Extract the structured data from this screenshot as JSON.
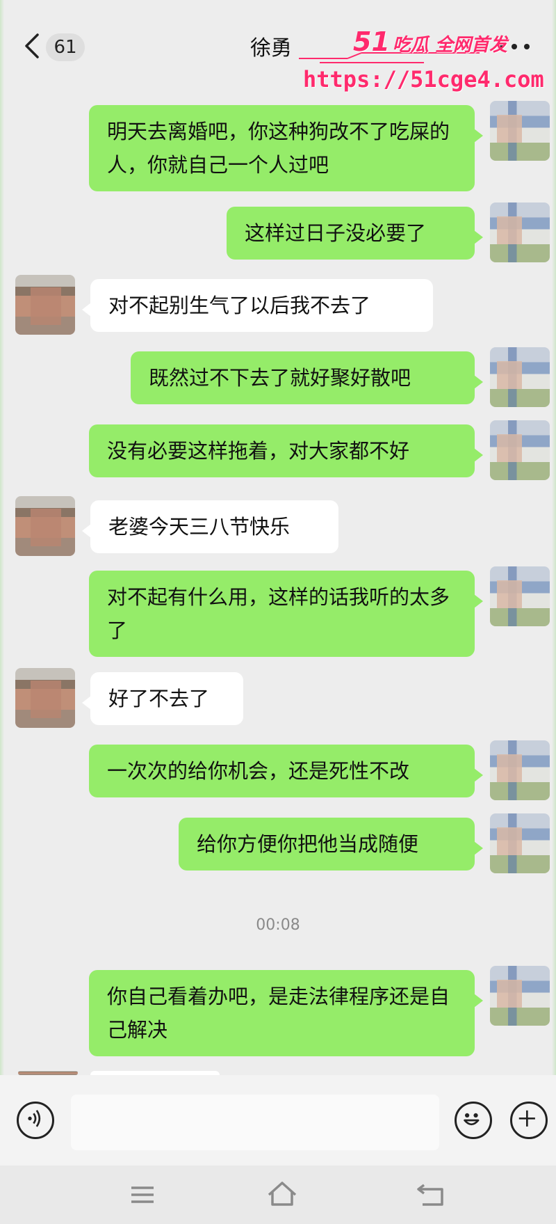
{
  "header": {
    "unread_count": "61",
    "contact_name": "徐勇",
    "watermark_logo": "51",
    "watermark_tag": "吃瓜 全网首发",
    "watermark_url": "https://51cge4.com"
  },
  "messages": [
    {
      "from": "me",
      "text": "明天去离婚吧，你这种狗改不了吃屎的人，你就自己一个人过吧"
    },
    {
      "from": "me",
      "text": "这样过日子没必要了"
    },
    {
      "from": "other",
      "text": "对不起别生气了以后我不去了"
    },
    {
      "from": "me",
      "text": "既然过不下去了就好聚好散吧"
    },
    {
      "from": "me",
      "text": "没有必要这样拖着，对大家都不好"
    },
    {
      "from": "other",
      "text": "老婆今天三八节快乐"
    },
    {
      "from": "me",
      "text": "对不起有什么用，这样的话我听的太多了"
    },
    {
      "from": "other",
      "text": "好了不去了"
    },
    {
      "from": "me",
      "text": "一次次的给你机会，还是死性不改"
    },
    {
      "from": "me",
      "text": "给你方便你把他当成随便"
    },
    {
      "from": "me",
      "text": "你自己看着办吧，是走法律程序还是自己解决"
    }
  ],
  "timestamp": "00:08",
  "icons": {
    "back": "chevron-left-icon",
    "more": "more-dots-icon",
    "voice": "voice-icon",
    "emoji": "emoji-icon",
    "plus": "plus-icon",
    "menu": "menu-icon",
    "home": "home-icon",
    "return": "back-nav-icon"
  },
  "colors": {
    "my_bubble": "#95ec69",
    "their_bubble": "#ffffff",
    "background": "#ededed",
    "watermark": "#ff2a6d"
  }
}
